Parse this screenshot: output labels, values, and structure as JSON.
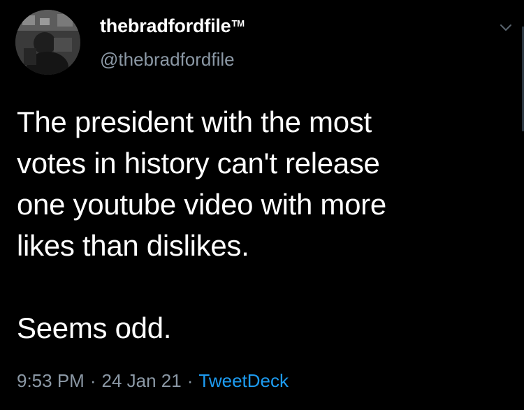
{
  "user": {
    "display_name": "thebradfordfile",
    "trademark": "TM",
    "handle": "@thebradfordfile",
    "avatar_icon": "profile-photo-icon"
  },
  "tweet": {
    "lines": [
      "The president with the most",
      "votes in history can't release",
      "one youtube video with more",
      "likes than dislikes."
    ],
    "closing": "Seems odd.",
    "time": "9:53 PM",
    "separator": "·",
    "date": "24 Jan 21",
    "source": "TweetDeck"
  },
  "colors": {
    "background": "#000000",
    "text": "#ffffff",
    "muted": "#8b98a5",
    "link": "#1d9bf0"
  },
  "icons": {
    "menu": "chevron-down-icon"
  }
}
